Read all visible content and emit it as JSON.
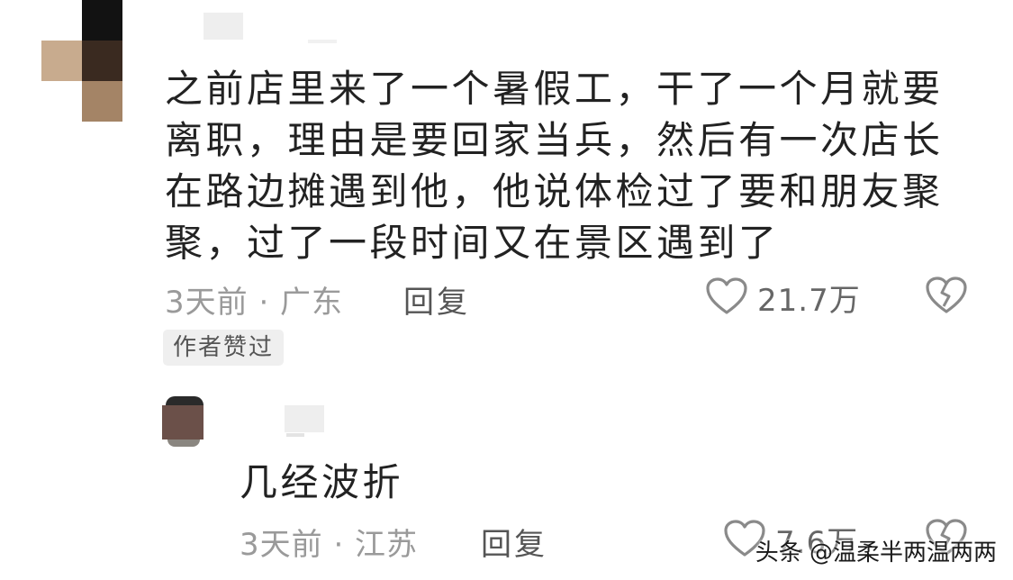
{
  "comment": {
    "text": "之前店里来了一个暑假工，干了一个月就要离职，理由是要回家当兵，然后有一次店长在路边摊遇到他，他说体检过了要和朋友聚聚，过了一段时间又在景区遇到了",
    "time_location": "3天前 · 广东",
    "reply_label": "回复",
    "like_count": "21.7万",
    "author_badge": "作者赞过"
  },
  "reply": {
    "text": "几经波折",
    "time_location": "3天前 · 江苏",
    "reply_label": "回复",
    "like_count": "7.6万"
  },
  "watermark": "头条 @温柔半两温两两",
  "colors": {
    "text": "#222222",
    "meta": "#9a9a9a",
    "badge_bg": "#efefef"
  },
  "icons": {
    "like": "heart-outline-icon",
    "dislike": "broken-heart-icon"
  }
}
